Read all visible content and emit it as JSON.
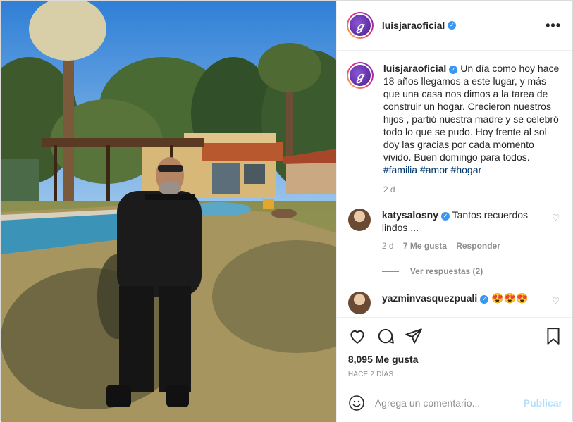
{
  "post": {
    "username": "luisjaraoficial",
    "more_glyph": "•••",
    "caption_text": "Un día como hoy hace 18 años llegamos a este lugar, y más que una casa nos dimos a la tarea de construir un hogar. Crecieron nuestros hijos , partió nuestra madre y se celebró todo lo que se pudo. Hoy frente al sol doy las gracias por cada momento vivido. Buen domingo para todos.",
    "hashtags": [
      "#familia",
      "#amor",
      "#hogar"
    ],
    "caption_age": "2 d",
    "likes": "8,095 Me gusta",
    "posted": "HACE 2 DÍAS"
  },
  "comments": [
    {
      "username": "katysalosny",
      "text": "Tantos recuerdos lindos ...",
      "age": "2 d",
      "likes": "7 Me gusta",
      "reply_label": "Responder",
      "view_replies": "Ver respuestas (2)"
    },
    {
      "username": "yazminvasquezpuali",
      "text": "😍😍😍"
    }
  ],
  "add_comment": {
    "placeholder": "Agrega un comentario...",
    "publish_label": "Publicar"
  },
  "icons": [
    "heart-icon",
    "comment-icon",
    "share-icon",
    "bookmark-icon",
    "emoji-icon",
    "verified-icon",
    "more-icon"
  ],
  "colors": {
    "verified": "#3897f0",
    "link": "#00376b",
    "publish_disabled": "#b2dffc",
    "muted": "#8e8e8e"
  }
}
